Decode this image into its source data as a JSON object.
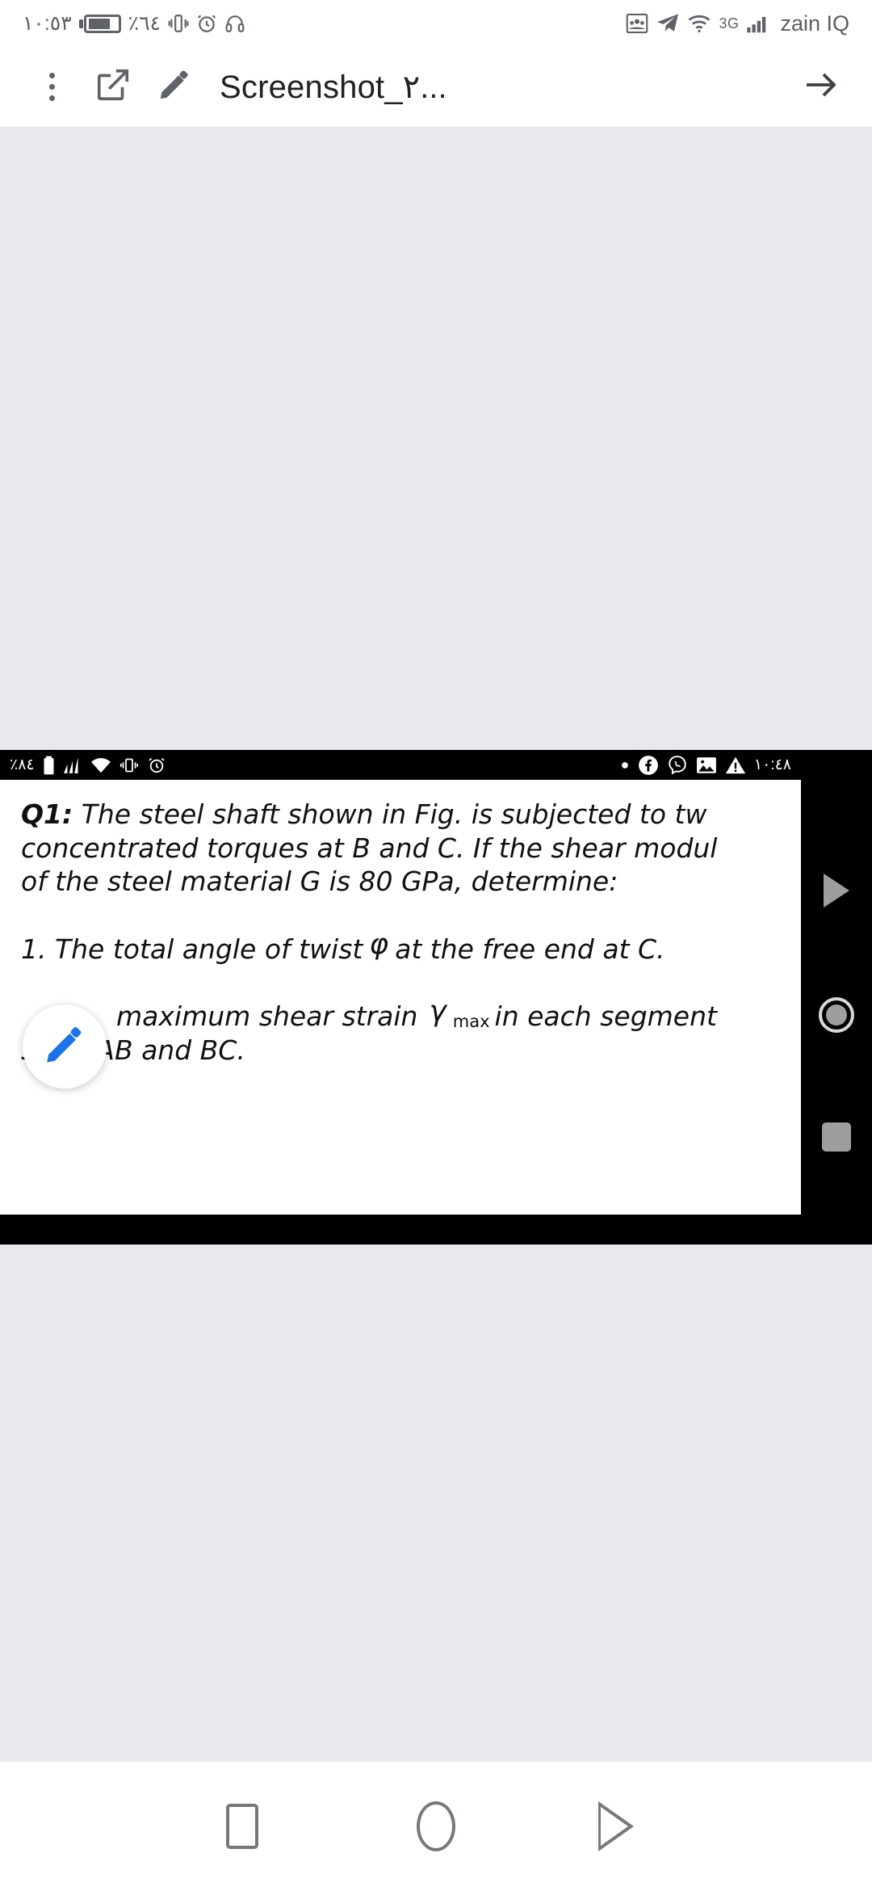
{
  "status_bar": {
    "time": "١٠:٥٣",
    "battery_percent": "٪٦٤",
    "carrier": "zain IQ",
    "network": "3G",
    "icons_left": [
      "battery-icon",
      "vibrate-icon",
      "alarm-icon",
      "headphones-icon"
    ],
    "icons_right": [
      "contacts-icon",
      "telegram-icon",
      "wifi-icon",
      "signal-icon"
    ]
  },
  "toolbar": {
    "overflow_label": "⋮",
    "share_icon": "external-link-icon",
    "edit_icon": "pencil-icon",
    "title": "Screenshot_٢...",
    "forward_icon": "arrow-right-icon"
  },
  "viewer": {
    "background_color": "#e8e9ec"
  },
  "screenshot": {
    "status_bar": {
      "battery_percent": "٪٨٤",
      "time": "١٠:٤٨",
      "icons_left": [
        "battery-icon",
        "signal-icon",
        "wifi-icon",
        "vibrate-icon",
        "alarm-icon"
      ],
      "icons_right": [
        "dot-icon",
        "facebook-icon",
        "viber-icon",
        "gallery-icon",
        "warning-icon"
      ]
    },
    "document": {
      "line1_lead": "Q1:",
      "line1": " The steel shaft shown in Fig. is subjected to tw",
      "line2": "concentrated torques at B and C. If the shear modul",
      "line3": "of the steel material G is 80 GPa, determine:",
      "line4_a": "1. The total angle of twist",
      "line4_symbol": "φ",
      "line4_b": "at the free end at C.",
      "line5_a": "maximum shear strain",
      "line5_symbol": "γ",
      "line5_symbol_sub": "max",
      "line5_b": "in each segment",
      "line6": "shaft AB and  BC."
    },
    "nav_bar": {
      "back_icon": "back-triangle-icon",
      "home_icon": "home-circle-icon",
      "recents_icon": "recents-square-icon"
    }
  },
  "fab": {
    "icon": "pencil-icon",
    "color": "#1a73e8"
  },
  "system_nav": {
    "recents_icon": "recents-square-icon",
    "home_icon": "home-circle-icon",
    "back_icon": "back-triangle-icon"
  }
}
